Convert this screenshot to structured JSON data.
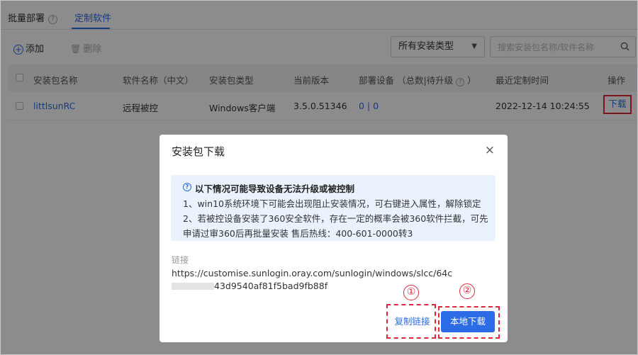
{
  "tabs": {
    "batch_deploy": "批量部署",
    "custom_software": "定制软件"
  },
  "toolbar": {
    "add_label": "添加",
    "delete_label": "删除",
    "type_select_value": "所有安装类型",
    "search_placeholder": "搜索安装包名称/软件名称"
  },
  "table": {
    "headers": {
      "package_name": "安装包名称",
      "software_name": "软件名称（中文）",
      "package_type": "安装包类型",
      "version": "当前版本",
      "deploy": "部署设备 （总数|待升级",
      "deploy_suffix": "）",
      "last_time": "最近定制时间",
      "action": "操作"
    },
    "rows": [
      {
        "package_name": "littlsunRC",
        "software_name": "远程被控",
        "package_type": "Windows客户端",
        "version": "3.5.0.51346",
        "deploy_total": "0",
        "deploy_sep": " | ",
        "deploy_pending": "0",
        "last_time": "2022-12-14 10:24:55",
        "action": "下载"
      }
    ]
  },
  "dialog": {
    "title": "安装包下载",
    "close": "×",
    "notice_title": "以下情况可能导致设备无法升级或被控制",
    "notice_line1": "1、win10系统环境下可能会出现阻止安装情况，可右键进入属性，解除锁定",
    "notice_line2": "2、若被控设备安装了360安全软件，存在一定的概率会被360软件拦截，可先",
    "notice_line3": "申请过审360后再批量安装 售后热线：400-601-0000转3",
    "link_label": "链接",
    "url_part1": "https://customise.sunlogin.oray.com/sunlogin/windows/slcc/64c",
    "url_part2": "43d9540af81f5bad9fb88f",
    "copy_button": "复制链接",
    "local_download_button": "本地下载"
  },
  "annotations": {
    "marker1": "①",
    "marker2": "②"
  },
  "colors": {
    "accent": "#2b6be6",
    "annotation_red": "#e0283c",
    "notice_bg": "#eaf3fd"
  }
}
